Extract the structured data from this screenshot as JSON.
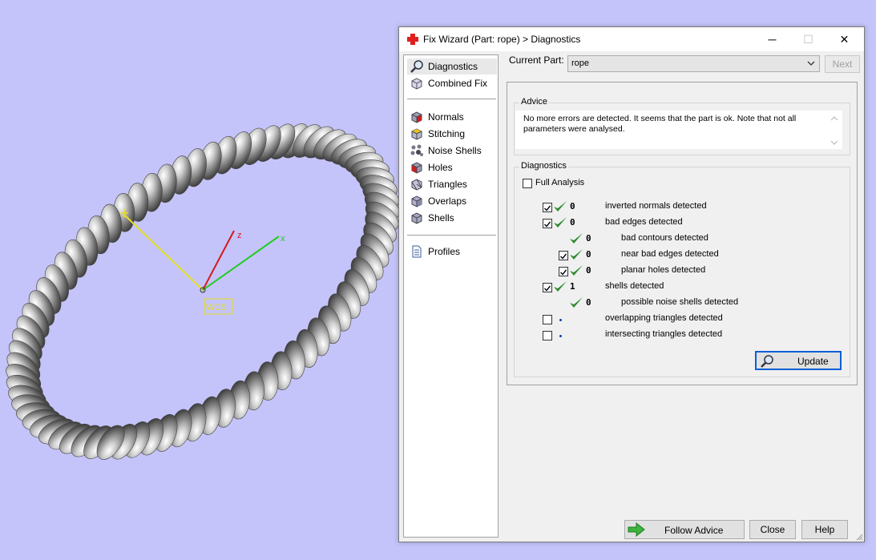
{
  "viewport": {
    "axis_label": "WCS",
    "z_label": "z",
    "x_label": "x",
    "bg_color": "#c4c4fa"
  },
  "dialog": {
    "title": "Fix Wizard (Part: rope) > Diagnostics",
    "minimize_glyph": "─",
    "maximize_glyph": "☐",
    "close_glyph": "✕"
  },
  "nav": {
    "top": [
      "Diagnostics",
      "Combined Fix"
    ],
    "tools": [
      "Normals",
      "Stitching",
      "Noise Shells",
      "Holes",
      "Triangles",
      "Overlaps",
      "Shells"
    ],
    "bottom": [
      "Profiles"
    ]
  },
  "current_part": {
    "label": "Current Part:",
    "value": "rope",
    "next_label": "Next"
  },
  "advice": {
    "title": "Advice",
    "text": "No more errors are detected. It seems that the part is ok. Note that not all parameters were analysed."
  },
  "diagnostics": {
    "title": "Diagnostics",
    "full_analysis_label": "Full Analysis",
    "rows": [
      {
        "count": "0",
        "label": "inverted normals detected",
        "checkbox": true,
        "checked": true,
        "ok": true
      },
      {
        "count": "0",
        "label": "bad edges detected",
        "checkbox": true,
        "checked": true,
        "ok": true
      },
      {
        "count": "0",
        "label": "bad contours detected",
        "checkbox": false,
        "checked": false,
        "ok": true
      },
      {
        "count": "0",
        "label": "near bad edges detected",
        "checkbox": true,
        "checked": true,
        "ok": true
      },
      {
        "count": "0",
        "label": "planar holes detected",
        "checkbox": true,
        "checked": true,
        "ok": true
      },
      {
        "count": "1",
        "label": "shells detected",
        "checkbox": true,
        "checked": true,
        "ok": true
      },
      {
        "count": "0",
        "label": "possible noise shells detected",
        "checkbox": false,
        "checked": false,
        "ok": true
      },
      {
        "count": "",
        "label": "overlapping triangles detected",
        "checkbox": true,
        "checked": false,
        "ok": false
      },
      {
        "count": "",
        "label": "intersecting triangles detected",
        "checkbox": true,
        "checked": false,
        "ok": false
      }
    ],
    "update_label": "Update"
  },
  "footer": {
    "follow_advice_label": "Follow Advice",
    "close_label": "Close",
    "help_label": "Help"
  },
  "colors": {
    "check_green": "#2e8b2e",
    "accent_blue": "#0b5fd6",
    "arrow_green": "#3cb43c",
    "title_icon_red": "#e02020"
  }
}
